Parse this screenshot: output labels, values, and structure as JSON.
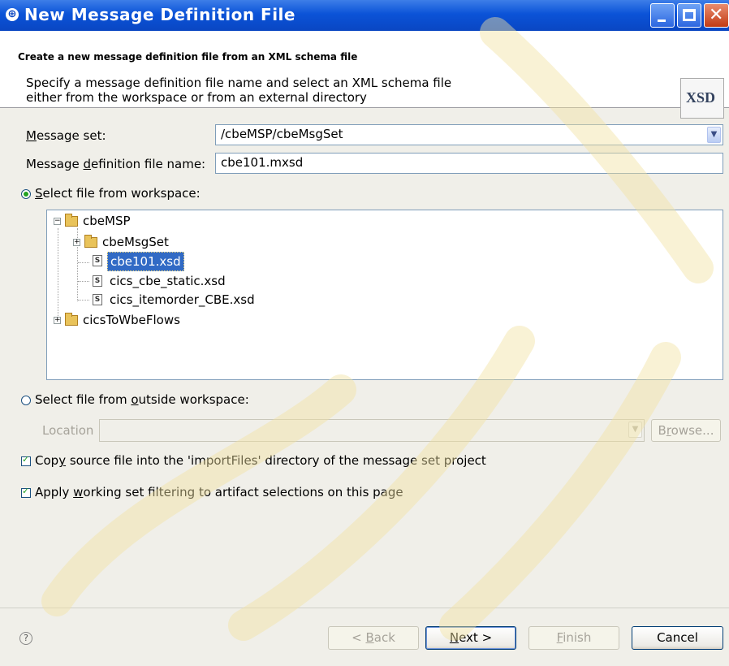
{
  "window": {
    "title": "New Message Definition File"
  },
  "header": {
    "title": "Create a new message definition file from an XML schema file",
    "description": "Specify a message definition file name and select an XML schema file either from the workspace or from an external directory",
    "icon": "XSD"
  },
  "form": {
    "message_set_label_pre": "M",
    "message_set_label_post": "essage set:",
    "message_set_value": "/cbeMSP/cbeMsgSet",
    "filename_label_pre": "Message ",
    "filename_label_mn": "d",
    "filename_label_post": "efinition file name:",
    "filename_value": "cbe101.mxsd",
    "radio_workspace_pre": "",
    "radio_workspace_mn": "S",
    "radio_workspace_post": "elect file from workspace:",
    "radio_outside_pre": "Select file from ",
    "radio_outside_mn": "o",
    "radio_outside_post": "utside workspace:",
    "location_label": "Location",
    "browse_pre": "B",
    "browse_mn": "r",
    "browse_post": "owse...",
    "copy_pre": "Cop",
    "copy_mn": "y",
    "copy_post": " source file into the 'importFiles' directory of the message set project",
    "apply_pre": "Apply ",
    "apply_mn": "w",
    "apply_post": "orking set filtering to artifact selections on this page"
  },
  "tree": {
    "nodes": [
      {
        "label": "cbeMSP"
      },
      {
        "label": "cbeMsgSet"
      },
      {
        "label": "cbe101.xsd"
      },
      {
        "label": "cics_cbe_static.xsd"
      },
      {
        "label": "cics_itemorder_CBE.xsd"
      },
      {
        "label": "cicsToWbeFlows"
      }
    ]
  },
  "buttons": {
    "back_pre": "< ",
    "back_mn": "B",
    "back_post": "ack",
    "next_pre": "",
    "next_mn": "N",
    "next_post": "ext >",
    "finish_pre": "",
    "finish_mn": "F",
    "finish_post": "inish",
    "cancel": "Cancel"
  },
  "colors": {
    "titlebar": "#0b53d8",
    "selection": "#316ac5",
    "watermark": "#f2e3a2"
  }
}
